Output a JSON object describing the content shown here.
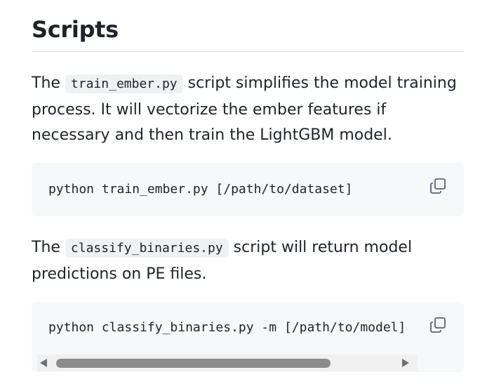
{
  "section": {
    "heading": "Scripts"
  },
  "para1": {
    "before": "The ",
    "code": "train_ember.py",
    "after": " script simplifies the model training process. It will vectorize the ember features if necessary and then train the LightGBM model."
  },
  "code_block1": {
    "command": "python train_ember.py [/path/to/dataset]",
    "copy_icon": "copy-icon"
  },
  "para2": {
    "before": "The ",
    "code": "classify_binaries.py",
    "after": " script will return model predictions on PE files."
  },
  "code_block2": {
    "command": "python classify_binaries.py -m [/path/to/model]",
    "copy_icon": "copy-icon",
    "scroll_position": 0.0
  },
  "colors": {
    "text": "#1f2328",
    "code_background": "#f6f8fa",
    "inline_code_background": "#eff1f3",
    "rule": "#d8dee4",
    "icon": "#59636e"
  }
}
